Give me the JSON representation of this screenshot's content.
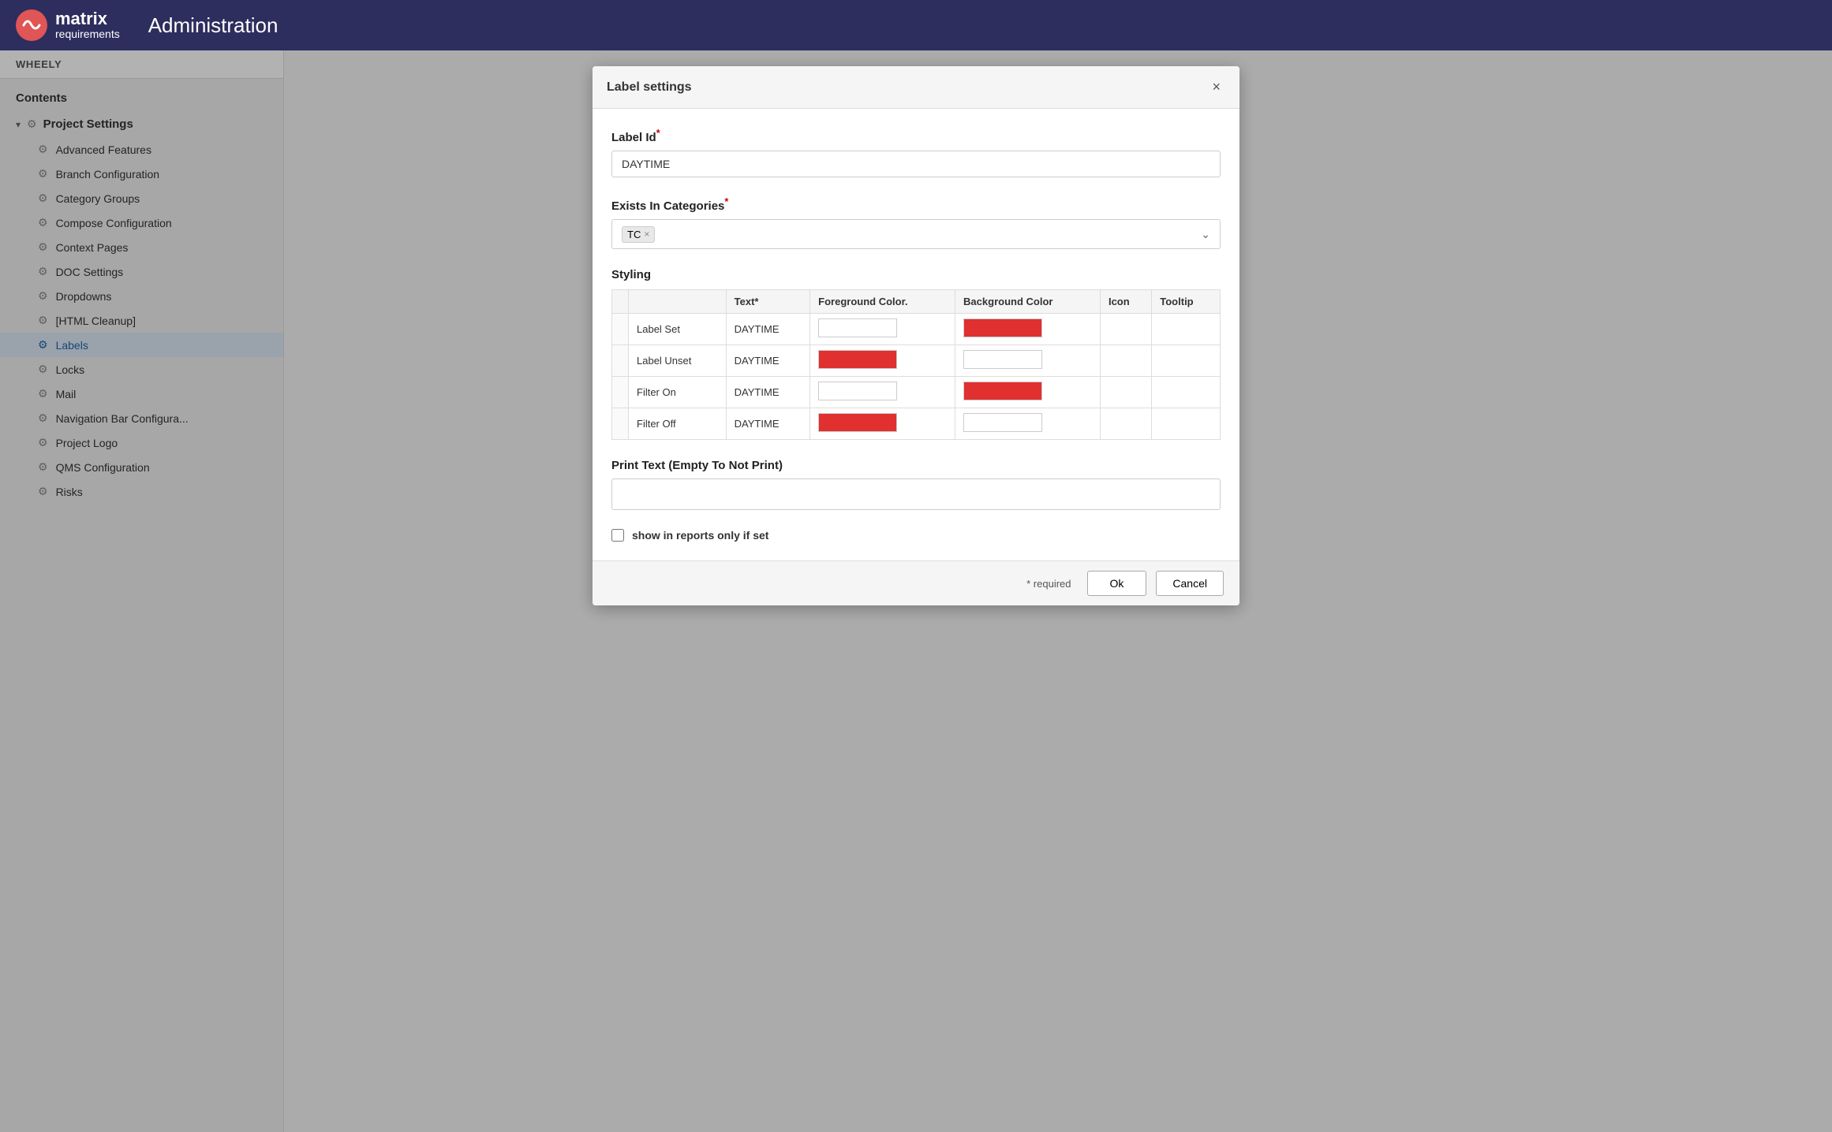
{
  "header": {
    "title": "Administration",
    "logo_matrix": "matrix",
    "logo_requirements": "requirements"
  },
  "sidebar": {
    "project_label": "WHEELY",
    "contents_label": "Contents",
    "section_title": "Project Settings",
    "items": [
      {
        "label": "Advanced Features"
      },
      {
        "label": "Branch Configuration"
      },
      {
        "label": "Category Groups"
      },
      {
        "label": "Compose Configuration"
      },
      {
        "label": "Context Pages"
      },
      {
        "label": "DOC Settings"
      },
      {
        "label": "Dropdowns"
      },
      {
        "label": "[HTML Cleanup]"
      },
      {
        "label": "Labels",
        "active": true
      },
      {
        "label": "Locks"
      },
      {
        "label": "Mail"
      },
      {
        "label": "Navigation Bar Configura..."
      },
      {
        "label": "Project Logo"
      },
      {
        "label": "QMS Configuration"
      },
      {
        "label": "Risks"
      }
    ]
  },
  "dialog": {
    "title": "Label settings",
    "close_label": "×",
    "label_id_label": "Label Id",
    "label_id_required": "*",
    "label_id_value": "DAYTIME",
    "exists_in_categories_label": "Exists In Categories",
    "exists_in_categories_required": "*",
    "category_tag": "TC",
    "styling_label": "Styling",
    "table_headers": [
      "",
      "Text*",
      "Foreground Color.",
      "Background Color",
      "Icon",
      "Tooltip"
    ],
    "table_rows": [
      {
        "row_label": "",
        "name": "Label Set",
        "text": "DAYTIME",
        "fg": "white",
        "bg": "red"
      },
      {
        "row_label": "",
        "name": "Label Unset",
        "text": "DAYTIME",
        "fg": "red",
        "bg": "white"
      },
      {
        "row_label": "",
        "name": "Filter On",
        "text": "DAYTIME",
        "fg": "white",
        "bg": "red"
      },
      {
        "row_label": "",
        "name": "Filter Off",
        "text": "DAYTIME",
        "fg": "red",
        "bg": "white"
      }
    ],
    "print_text_label": "Print Text (Empty To Not Print)",
    "print_text_value": "",
    "checkbox_label": "show in reports only if set",
    "required_note": "* required",
    "ok_label": "Ok",
    "cancel_label": "Cancel"
  }
}
